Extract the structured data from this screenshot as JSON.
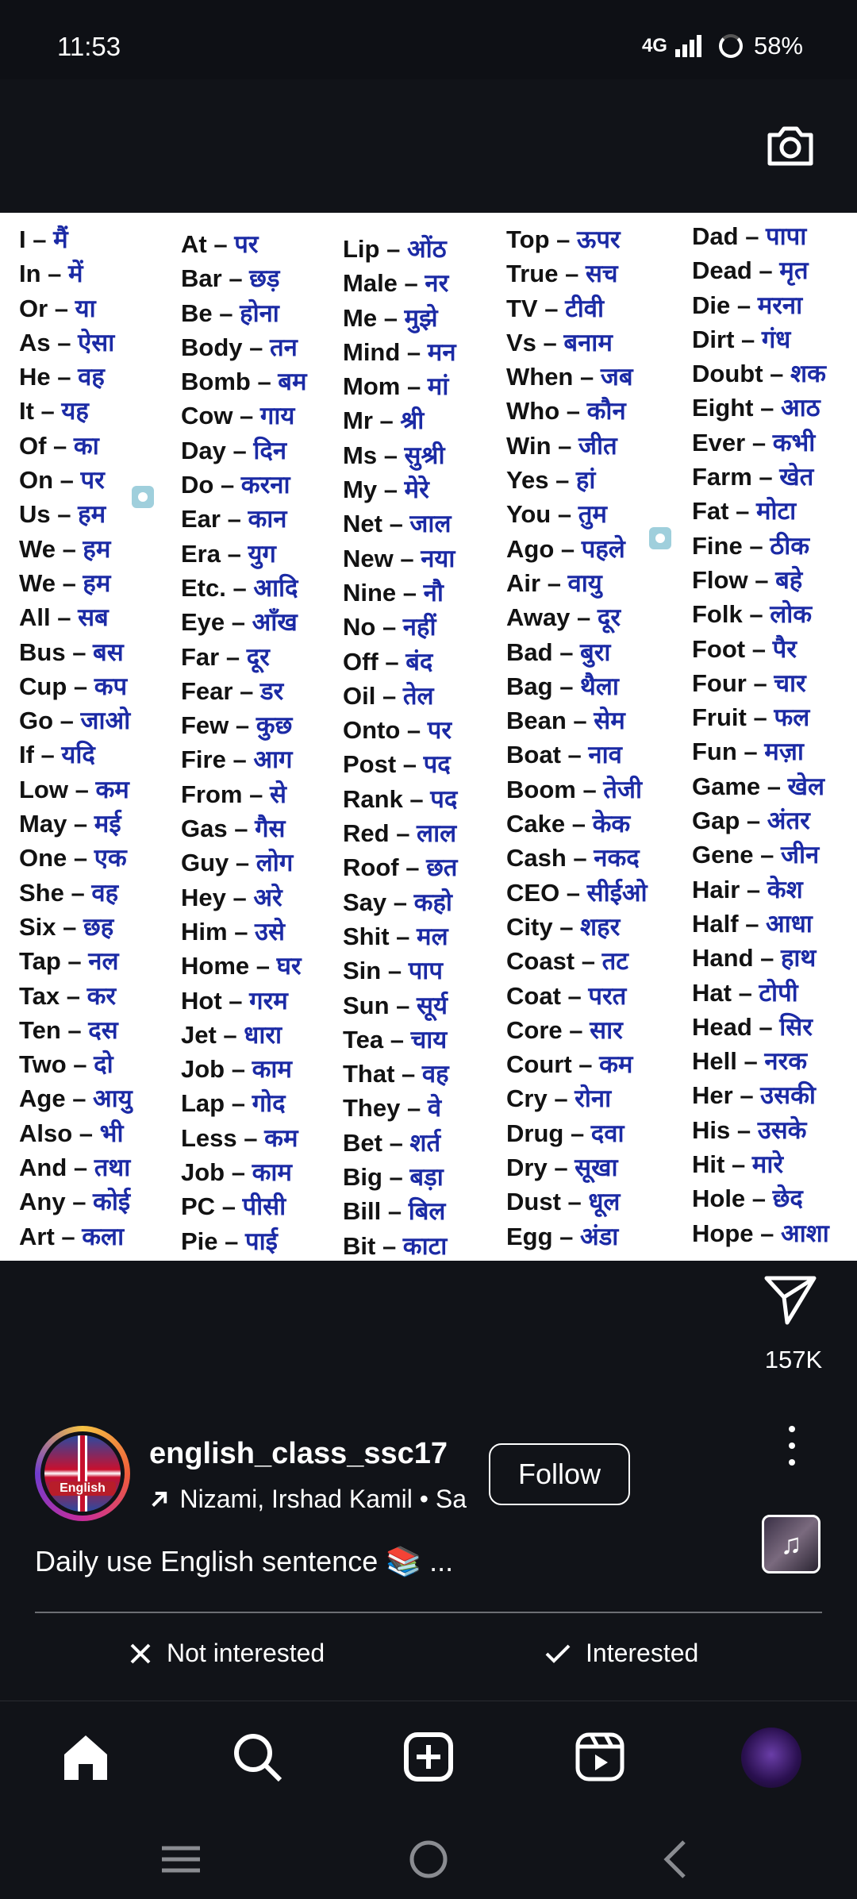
{
  "status": {
    "time": "11:53",
    "network": "4G",
    "battery": "58%"
  },
  "vocab_columns": [
    [
      [
        "I",
        "मैं"
      ],
      [
        "In",
        "में"
      ],
      [
        "Or",
        "या"
      ],
      [
        "As",
        "ऐसा"
      ],
      [
        "He",
        "वह"
      ],
      [
        "It",
        "यह"
      ],
      [
        "Of",
        "का"
      ],
      [
        "On",
        "पर"
      ],
      [
        "Us",
        "हम"
      ],
      [
        "We",
        "हम"
      ],
      [
        "We",
        "हम"
      ],
      [
        "All",
        "सब"
      ],
      [
        "Bus",
        "बस"
      ],
      [
        "Cup",
        "कप"
      ],
      [
        "Go",
        "जाओ"
      ],
      [
        "If",
        "यदि"
      ],
      [
        "Low",
        "कम"
      ],
      [
        "May",
        "मई"
      ],
      [
        "One",
        "एक"
      ],
      [
        "She",
        "वह"
      ],
      [
        "Six",
        "छह"
      ],
      [
        "Tap",
        "नल"
      ],
      [
        "Tax",
        "कर"
      ],
      [
        "Ten",
        "दस"
      ],
      [
        "Two",
        "दो"
      ],
      [
        "Age",
        "आयु"
      ],
      [
        "Also",
        "भी"
      ],
      [
        "And",
        "तथा"
      ],
      [
        "Any",
        "कोई"
      ],
      [
        "Art",
        "कला"
      ]
    ],
    [
      [
        "At",
        "पर"
      ],
      [
        "Bar",
        "छड़"
      ],
      [
        "Be",
        "होना"
      ],
      [
        "Body",
        "तन"
      ],
      [
        "Bomb",
        "बम"
      ],
      [
        "Cow",
        "गाय"
      ],
      [
        "Day",
        "दिन"
      ],
      [
        "Do",
        "करना"
      ],
      [
        "Ear",
        "कान"
      ],
      [
        "Era",
        "युग"
      ],
      [
        "Etc.",
        "आदि"
      ],
      [
        "Eye",
        "आँख"
      ],
      [
        "Far",
        "दूर"
      ],
      [
        "Fear",
        "डर"
      ],
      [
        "Few",
        "कुछ"
      ],
      [
        "Fire",
        "आग"
      ],
      [
        "From",
        "से"
      ],
      [
        "Gas",
        "गैस"
      ],
      [
        "Guy",
        "लोग"
      ],
      [
        "Hey",
        "अरे"
      ],
      [
        "Him",
        "उसे"
      ],
      [
        "Home",
        "घर"
      ],
      [
        "Hot",
        "गरम"
      ],
      [
        "Jet",
        "धारा"
      ],
      [
        "Job",
        "काम"
      ],
      [
        "Lap",
        "गोद"
      ],
      [
        "Less",
        "कम"
      ],
      [
        "Job",
        "काम"
      ],
      [
        "PC",
        "पीसी"
      ],
      [
        "Pie",
        "पाई"
      ]
    ],
    [
      [
        "Lip",
        "ओंठ"
      ],
      [
        "Male",
        "नर"
      ],
      [
        "Me",
        "मुझे"
      ],
      [
        "Mind",
        "मन"
      ],
      [
        "Mom",
        "मां"
      ],
      [
        "Mr",
        "श्री"
      ],
      [
        "Ms",
        "सुश्री"
      ],
      [
        "My",
        "मेरे"
      ],
      [
        "Net",
        "जाल"
      ],
      [
        "New",
        "नया"
      ],
      [
        "Nine",
        "नौ"
      ],
      [
        "No",
        "नहीं"
      ],
      [
        "Off",
        "बंद"
      ],
      [
        "Oil",
        "तेल"
      ],
      [
        "Onto",
        "पर"
      ],
      [
        "Post",
        "पद"
      ],
      [
        "Rank",
        "पद"
      ],
      [
        "Red",
        "लाल"
      ],
      [
        "Roof",
        "छत"
      ],
      [
        "Say",
        "कहो"
      ],
      [
        "Shit",
        "मल"
      ],
      [
        "Sin",
        "पाप"
      ],
      [
        "Sun",
        "सूर्य"
      ],
      [
        "Tea",
        "चाय"
      ],
      [
        "That",
        "वह"
      ],
      [
        "They",
        "वे"
      ],
      [
        "Bet",
        "शर्त"
      ],
      [
        "Big",
        "बड़ा"
      ],
      [
        "Bill",
        "बिल"
      ],
      [
        "Bit",
        "काटा"
      ]
    ],
    [
      [
        "Top",
        "ऊपर"
      ],
      [
        "True",
        "सच"
      ],
      [
        "TV",
        "टीवी"
      ],
      [
        "Vs",
        "बनाम"
      ],
      [
        "When",
        "जब"
      ],
      [
        "Who",
        "कौन"
      ],
      [
        "Win",
        "जीत"
      ],
      [
        "Yes",
        "हां"
      ],
      [
        "You",
        "तुम"
      ],
      [
        "Ago",
        "पहले"
      ],
      [
        "Air",
        "वायु"
      ],
      [
        "Away",
        "दूर"
      ],
      [
        "Bad",
        "बुरा"
      ],
      [
        "Bag",
        "थैला"
      ],
      [
        "Bean",
        "सेम"
      ],
      [
        "Boat",
        "नाव"
      ],
      [
        "Boom",
        "तेजी"
      ],
      [
        "Cake",
        "केक"
      ],
      [
        "Cash",
        "नकद"
      ],
      [
        "CEO",
        "सीईओ"
      ],
      [
        "City",
        "शहर"
      ],
      [
        "Coast",
        "तट"
      ],
      [
        "Coat",
        "परत"
      ],
      [
        "Core",
        "सार"
      ],
      [
        "Court",
        "कम"
      ],
      [
        "Cry",
        "रोना"
      ],
      [
        "Drug",
        "दवा"
      ],
      [
        "Dry",
        "सूखा"
      ],
      [
        "Dust",
        "धूल"
      ],
      [
        "Egg",
        "अंडा"
      ]
    ],
    [
      [
        "Dad",
        "पापा"
      ],
      [
        "Dead",
        "मृत"
      ],
      [
        "Die",
        "मरना"
      ],
      [
        "Dirt",
        "गंध"
      ],
      [
        "Doubt",
        "शक"
      ],
      [
        "Eight",
        "आठ"
      ],
      [
        "Ever",
        "कभी"
      ],
      [
        "Farm",
        "खेत"
      ],
      [
        "Fat",
        "मोटा"
      ],
      [
        "Fine",
        "ठीक"
      ],
      [
        "Flow",
        "बहे"
      ],
      [
        "Folk",
        "लोक"
      ],
      [
        "Foot",
        "पैर"
      ],
      [
        "Four",
        "चार"
      ],
      [
        "Fruit",
        "फल"
      ],
      [
        "Fun",
        "मज़ा"
      ],
      [
        "Game",
        "खेल"
      ],
      [
        "Gap",
        "अंतर"
      ],
      [
        "Gene",
        "जीन"
      ],
      [
        "Hair",
        "केश"
      ],
      [
        "Half",
        "आधा"
      ],
      [
        "Hand",
        "हाथ"
      ],
      [
        "Hat",
        "टोपी"
      ],
      [
        "Head",
        "सिर"
      ],
      [
        "Hell",
        "नरक"
      ],
      [
        "Her",
        "उसकी"
      ],
      [
        "His",
        "उसके"
      ],
      [
        "Hit",
        "मारे"
      ],
      [
        "Hole",
        "छेद"
      ],
      [
        "Hope",
        "आशा"
      ]
    ]
  ],
  "actions": {
    "share_count": "157K"
  },
  "post": {
    "avatar_label": "English",
    "username": "english_class_ssc17",
    "audio_text": "Nizami, Irshad Kamil • Sa",
    "follow_label": "Follow",
    "caption": "Daily use English sentence 📚 ...",
    "not_interested_label": "Not interested",
    "interested_label": "Interested"
  }
}
